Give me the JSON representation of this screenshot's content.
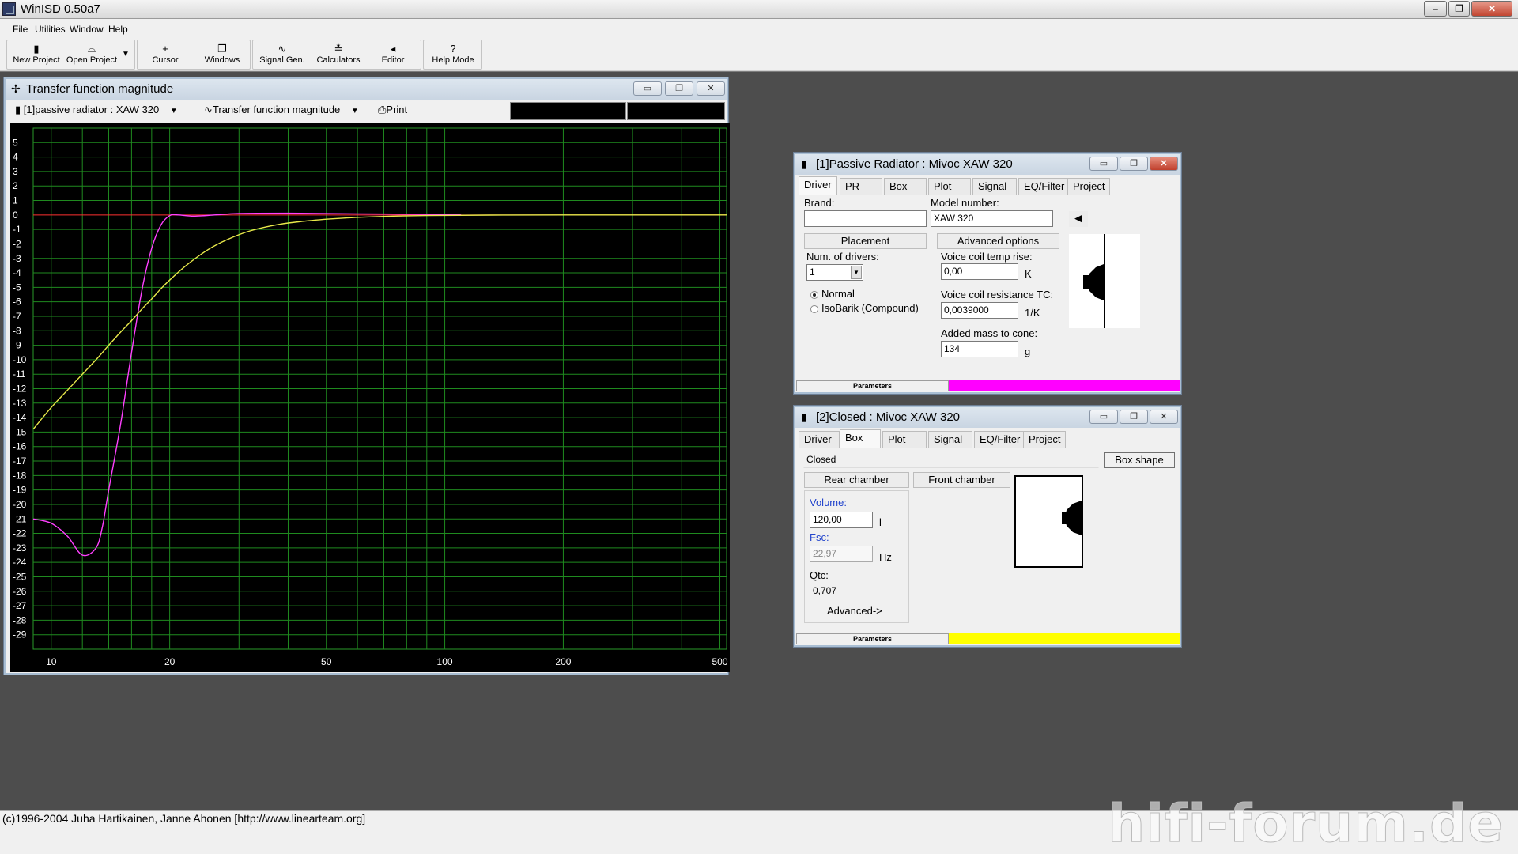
{
  "app": {
    "title": "WinISD 0.50a7",
    "window_controls": [
      "–",
      "❐",
      "✕"
    ]
  },
  "menu": [
    "File",
    "Utilities",
    "Window",
    "Help"
  ],
  "toolbar": {
    "buttons": [
      {
        "label": "New Project",
        "icon": "▮"
      },
      {
        "label": "Open Project",
        "icon": "⌓"
      },
      {
        "label": "Cursor",
        "icon": "+"
      },
      {
        "label": "Windows",
        "icon": "❐"
      },
      {
        "label": "Signal Gen.",
        "icon": "∿"
      },
      {
        "label": "Calculators",
        "icon": "≛"
      },
      {
        "label": "Editor",
        "icon": "◂"
      },
      {
        "label": "Help Mode",
        "icon": "?"
      }
    ],
    "dropdown_arrow": "▼"
  },
  "graph_window": {
    "title": "Transfer function magnitude",
    "project_select": "[1]passive radiator : XAW 320",
    "graph_select": "Transfer function magnitude",
    "print_label": "Print",
    "controls": [
      "▭",
      "❐",
      "✕"
    ]
  },
  "chart_data": {
    "type": "line",
    "x_scale": "log",
    "xlim": [
      9,
      520
    ],
    "ylim": [
      -30,
      6
    ],
    "y_ticks": [
      5,
      4,
      3,
      2,
      1,
      0,
      -1,
      -2,
      -3,
      -4,
      -5,
      -6,
      -7,
      -8,
      -9,
      -10,
      -11,
      -12,
      -13,
      -14,
      -15,
      -16,
      -17,
      -18,
      -19,
      -20,
      -21,
      -22,
      -23,
      -24,
      -25,
      -26,
      -27,
      -28,
      -29
    ],
    "x_ticks": [
      10,
      20,
      50,
      100,
      200,
      500
    ],
    "x_gridlines": [
      10,
      12,
      14,
      16,
      18,
      20,
      30,
      40,
      50,
      60,
      70,
      80,
      90,
      100,
      200,
      300,
      400,
      500
    ],
    "grid": true,
    "grid_color": "#1f8a1f",
    "background": "#000000",
    "zero_line_color": "#ff3030",
    "series": [
      {
        "color": "#ff40ff",
        "x": [
          9,
          10,
          11,
          12,
          13,
          13.5,
          14,
          15,
          16,
          17,
          18,
          19,
          20,
          21,
          23,
          26,
          30,
          40,
          60,
          100,
          110
        ],
        "y": [
          -21,
          -21.3,
          -22.2,
          -23.5,
          -23.0,
          -21.5,
          -19.0,
          -14.5,
          -9.5,
          -5.2,
          -2.3,
          -0.7,
          -0.05,
          0.0,
          -0.08,
          0.0,
          0.1,
          0.12,
          0.08,
          0.03,
          0.0
        ]
      },
      {
        "color": "#e8e84a",
        "x": [
          9,
          10,
          11,
          12,
          13,
          14,
          15,
          16,
          17,
          18,
          19,
          20,
          22,
          25,
          28,
          32,
          38,
          45,
          55,
          70,
          90,
          130,
          200,
          520
        ],
        "y": [
          -14.8,
          -13.3,
          -12.1,
          -11.0,
          -10.0,
          -9.0,
          -8.1,
          -7.3,
          -6.5,
          -5.8,
          -5.1,
          -4.5,
          -3.5,
          -2.4,
          -1.7,
          -1.1,
          -0.65,
          -0.4,
          -0.22,
          -0.1,
          -0.04,
          -0.01,
          0,
          0
        ]
      }
    ]
  },
  "pr_window": {
    "title": "[1]Passive Radiator : Mivoc XAW 320",
    "controls": [
      "▭",
      "❐",
      "✕"
    ],
    "tabs": [
      "Driver",
      "PR",
      "Box",
      "Plot",
      "Signal",
      "EQ/Filter",
      "Project"
    ],
    "brand_label": "Brand:",
    "brand_value": "",
    "model_label": "Model number:",
    "model_value": "XAW 320",
    "speaker_icon": "◀",
    "placement_label": "Placement",
    "advanced_label": "Advanced options",
    "num_drivers_label": "Num. of drivers:",
    "num_drivers_value": "1",
    "normal_label": "Normal",
    "isobarik_label": "IsoBarik (Compound)",
    "vc_temp_label": "Voice coil temp rise:",
    "vc_temp_value": "0,00",
    "vc_temp_unit": "K",
    "vc_res_label": "Voice coil resistance TC:",
    "vc_res_value": "0,0039000",
    "vc_res_unit": "1/K",
    "added_mass_label": "Added mass to cone:",
    "added_mass_value": "134",
    "added_mass_unit": "g",
    "params_label": "Parameters",
    "params_color": "#ff00ff"
  },
  "closed_window": {
    "title": "[2]Closed : Mivoc XAW 320",
    "controls": [
      "▭",
      "❐",
      "✕"
    ],
    "tabs": [
      "Driver",
      "Box",
      "Plot",
      "Signal",
      "EQ/Filter",
      "Project"
    ],
    "box_type_value": "Closed",
    "box_shape_label": "Box shape",
    "rear_label": "Rear chamber",
    "front_label": "Front chamber",
    "volume_label": "Volume:",
    "volume_value": "120,00",
    "volume_unit": "l",
    "fsc_label": "Fsc:",
    "fsc_value": "22,97",
    "fsc_unit": "Hz",
    "qtc_label": "Qtc:",
    "qtc_value": "0,707",
    "advanced_label": "Advanced->",
    "params_label": "Parameters",
    "params_color": "#ffff00"
  },
  "status": {
    "text": "(c)1996-2004 Juha Hartikainen, Janne Ahonen [http://www.linearteam.org]",
    "watermark": "hifi-forum.de"
  }
}
